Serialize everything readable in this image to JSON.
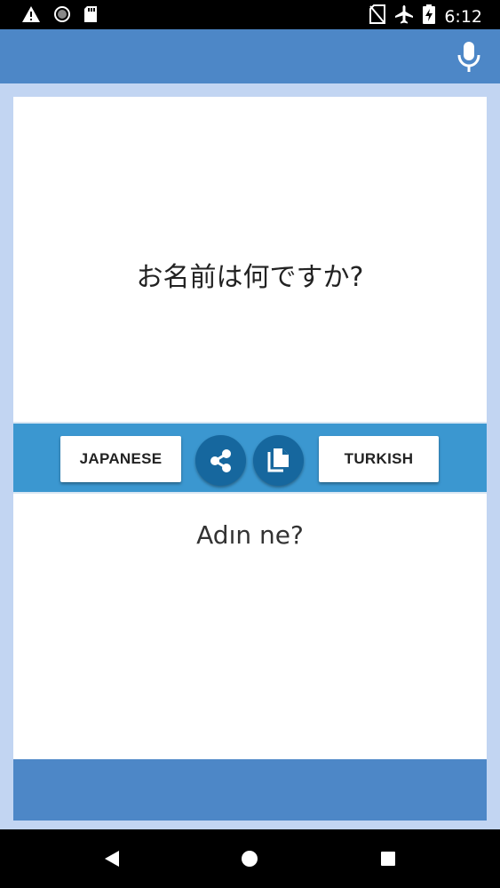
{
  "status_bar": {
    "time": "6:12",
    "left_icons": [
      "warning-icon",
      "circle-status-icon",
      "sd-card-icon"
    ],
    "right_icons": [
      "no-sim-icon",
      "airplane-mode-icon",
      "battery-charging-icon"
    ]
  },
  "toolbar": {
    "accent_color": "#4d87c7",
    "mic_icon": "microphone-icon"
  },
  "translator": {
    "source_text": "お名前は何ですか?",
    "target_text": "Adın ne?",
    "source_language": "JAPANESE",
    "target_language": "TURKISH",
    "share_icon": "share-icon",
    "copy_icon": "copy-icon",
    "bar_color": "#3b97d0",
    "round_button_color": "#16679e"
  },
  "nav_bar": {
    "buttons": [
      "back-icon",
      "home-icon",
      "recents-icon"
    ]
  }
}
